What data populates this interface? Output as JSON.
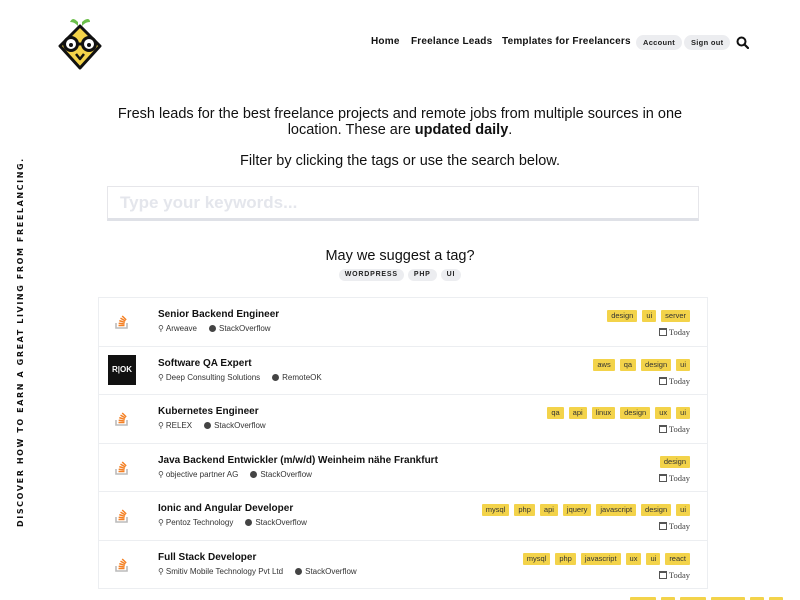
{
  "side_text": "DISCOVER HOW TO EARN A GREAT LIVING FROM FREELANCING.",
  "nav": {
    "home": "Home",
    "freelance_leads": "Freelance Leads",
    "templates": "Templates for Freelancers",
    "account": "Account",
    "sign_out": "Sign out"
  },
  "hero": {
    "line1": "Fresh leads for the best freelance projects and remote jobs from multiple sources in one",
    "line2_prefix": "location. These are ",
    "line2_bold": "updated daily",
    "line2_suffix": ".",
    "filter_text": "Filter by clicking the tags or use the search below."
  },
  "search": {
    "placeholder": "Type your keywords..."
  },
  "suggest": {
    "heading": "May we suggest a tag?",
    "tags": [
      "WORDPRESS",
      "PHP",
      "UI"
    ]
  },
  "jobs": [
    {
      "title": "Senior Backend Engineer",
      "company": "Arweave",
      "source": "StackOverflow",
      "tags": [
        "design",
        "ui",
        "server"
      ],
      "date": "Today",
      "logo": "stackoverflow-logo"
    },
    {
      "title": "Software QA Expert",
      "company": "Deep Consulting Solutions",
      "source": "RemoteOK",
      "tags": [
        "aws",
        "qa",
        "design",
        "ui"
      ],
      "date": "Today",
      "logo": "remoteok-logo"
    },
    {
      "title": "Kubernetes Engineer",
      "company": "RELEX",
      "source": "StackOverflow",
      "tags": [
        "qa",
        "api",
        "linux",
        "design",
        "ux",
        "ui"
      ],
      "date": "Today",
      "logo": "stackoverflow-logo"
    },
    {
      "title": "Java Backend Entwickler (m/w/d) Weinheim nähe Frankfurt",
      "company": "objective partner AG",
      "source": "StackOverflow",
      "tags": [
        "design"
      ],
      "date": "Today",
      "logo": "stackoverflow-logo"
    },
    {
      "title": "Ionic and Angular Developer",
      "company": "Pentoz Technology",
      "source": "StackOverflow",
      "tags": [
        "mysql",
        "php",
        "api",
        "jquery",
        "javascript",
        "design",
        "ui"
      ],
      "date": "Today",
      "logo": "stackoverflow-logo"
    },
    {
      "title": "Full Stack Developer",
      "company": "Smitiv Mobile Technology Pvt Ltd",
      "source": "StackOverflow",
      "tags": [
        "mysql",
        "php",
        "javascript",
        "ux",
        "ui",
        "react"
      ],
      "date": "Today",
      "logo": "stackoverflow-logo"
    }
  ],
  "remoteok_logo_text": "R|OK"
}
